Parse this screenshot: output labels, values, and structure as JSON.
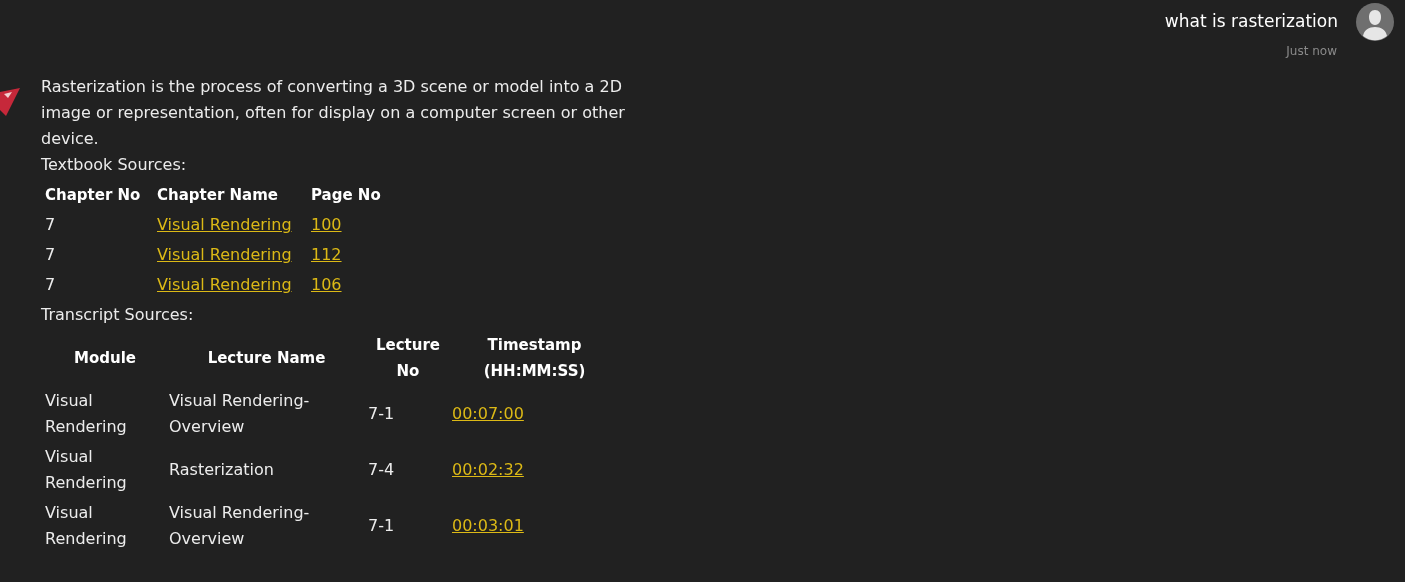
{
  "user_message": {
    "text": "what is rasterization",
    "time": "Just now"
  },
  "bot_message": {
    "answer": "Rasterization is the process of converting a 3D scene or model into a 2D image or representation, often for display on a computer screen or other device.",
    "textbook_sources": {
      "label": "Textbook Sources:",
      "columns": [
        {
          "title": "Chapter No",
          "kind": "text"
        },
        {
          "title": "Chapter Name",
          "kind": "link"
        },
        {
          "title": "Page No",
          "kind": "link"
        }
      ],
      "rows": [
        [
          "7",
          "Visual Rendering",
          "100"
        ],
        [
          "7",
          "Visual Rendering",
          "112"
        ],
        [
          "7",
          "Visual Rendering",
          "106"
        ]
      ]
    },
    "transcript_sources": {
      "label": "Transcript Sources:",
      "columns": [
        {
          "title": "Module",
          "kind": "text"
        },
        {
          "title": "Lecture Name",
          "kind": "text"
        },
        {
          "title": "Lecture No",
          "kind": "text"
        },
        {
          "title": "Timestamp (HH:MM:SS)",
          "kind": "link"
        }
      ],
      "rows": [
        [
          "Visual Rendering",
          "Visual Rendering-Overview",
          "7-1",
          "00:07:00"
        ],
        [
          "Visual Rendering",
          "Rasterization",
          "7-4",
          "00:02:32"
        ],
        [
          "Visual Rendering",
          "Visual Rendering-Overview",
          "7-1",
          "00:03:01"
        ]
      ]
    }
  }
}
